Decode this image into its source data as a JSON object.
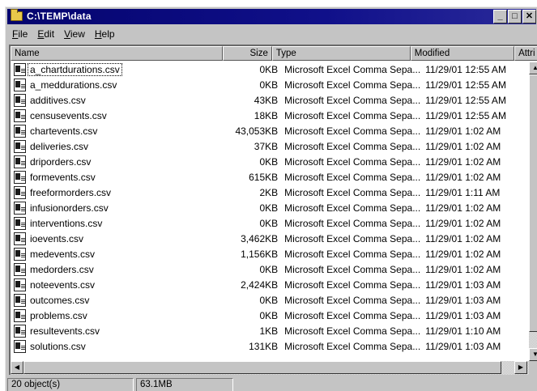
{
  "window": {
    "title": "C:\\TEMP\\data",
    "buttons": [
      "_",
      "□",
      "✕"
    ]
  },
  "menu": [
    {
      "underline": "F",
      "rest": "ile"
    },
    {
      "underline": "E",
      "rest": "dit"
    },
    {
      "underline": "V",
      "rest": "iew"
    },
    {
      "underline": "H",
      "rest": "elp"
    }
  ],
  "columns": {
    "name": "Name",
    "size": "Size",
    "type": "Type",
    "modified": "Modified",
    "attributes": "Attri"
  },
  "files": [
    {
      "name": "a_chartdurations.csv",
      "size": "0KB",
      "type": "Microsoft Excel Comma Sepa...",
      "modified": "11/29/01 12:55 AM"
    },
    {
      "name": "a_meddurations.csv",
      "size": "0KB",
      "type": "Microsoft Excel Comma Sepa...",
      "modified": "11/29/01 12:55 AM"
    },
    {
      "name": "additives.csv",
      "size": "43KB",
      "type": "Microsoft Excel Comma Sepa...",
      "modified": "11/29/01 12:55 AM"
    },
    {
      "name": "censusevents.csv",
      "size": "18KB",
      "type": "Microsoft Excel Comma Sepa...",
      "modified": "11/29/01 12:55 AM"
    },
    {
      "name": "chartevents.csv",
      "size": "43,053KB",
      "type": "Microsoft Excel Comma Sepa...",
      "modified": "11/29/01 1:02 AM"
    },
    {
      "name": "deliveries.csv",
      "size": "37KB",
      "type": "Microsoft Excel Comma Sepa...",
      "modified": "11/29/01 1:02 AM"
    },
    {
      "name": "driporders.csv",
      "size": "0KB",
      "type": "Microsoft Excel Comma Sepa...",
      "modified": "11/29/01 1:02 AM"
    },
    {
      "name": "formevents.csv",
      "size": "615KB",
      "type": "Microsoft Excel Comma Sepa...",
      "modified": "11/29/01 1:02 AM"
    },
    {
      "name": "freeformorders.csv",
      "size": "2KB",
      "type": "Microsoft Excel Comma Sepa...",
      "modified": "11/29/01 1:11 AM"
    },
    {
      "name": "infusionorders.csv",
      "size": "0KB",
      "type": "Microsoft Excel Comma Sepa...",
      "modified": "11/29/01 1:02 AM"
    },
    {
      "name": "interventions.csv",
      "size": "0KB",
      "type": "Microsoft Excel Comma Sepa...",
      "modified": "11/29/01 1:02 AM"
    },
    {
      "name": "ioevents.csv",
      "size": "3,462KB",
      "type": "Microsoft Excel Comma Sepa...",
      "modified": "11/29/01 1:02 AM"
    },
    {
      "name": "medevents.csv",
      "size": "1,156KB",
      "type": "Microsoft Excel Comma Sepa...",
      "modified": "11/29/01 1:02 AM"
    },
    {
      "name": "medorders.csv",
      "size": "0KB",
      "type": "Microsoft Excel Comma Sepa...",
      "modified": "11/29/01 1:02 AM"
    },
    {
      "name": "noteevents.csv",
      "size": "2,424KB",
      "type": "Microsoft Excel Comma Sepa...",
      "modified": "11/29/01 1:03 AM"
    },
    {
      "name": "outcomes.csv",
      "size": "0KB",
      "type": "Microsoft Excel Comma Sepa...",
      "modified": "11/29/01 1:03 AM"
    },
    {
      "name": "problems.csv",
      "size": "0KB",
      "type": "Microsoft Excel Comma Sepa...",
      "modified": "11/29/01 1:03 AM"
    },
    {
      "name": "resultevents.csv",
      "size": "1KB",
      "type": "Microsoft Excel Comma Sepa...",
      "modified": "11/29/01 1:10 AM"
    },
    {
      "name": "solutions.csv",
      "size": "131KB",
      "type": "Microsoft Excel Comma Sepa...",
      "modified": "11/29/01 1:03 AM"
    }
  ],
  "status": {
    "objects": "20 object(s)",
    "total_size": "63.1MB"
  },
  "icons": {
    "title": "folder-icon",
    "file": "excel-csv-file-icon"
  }
}
